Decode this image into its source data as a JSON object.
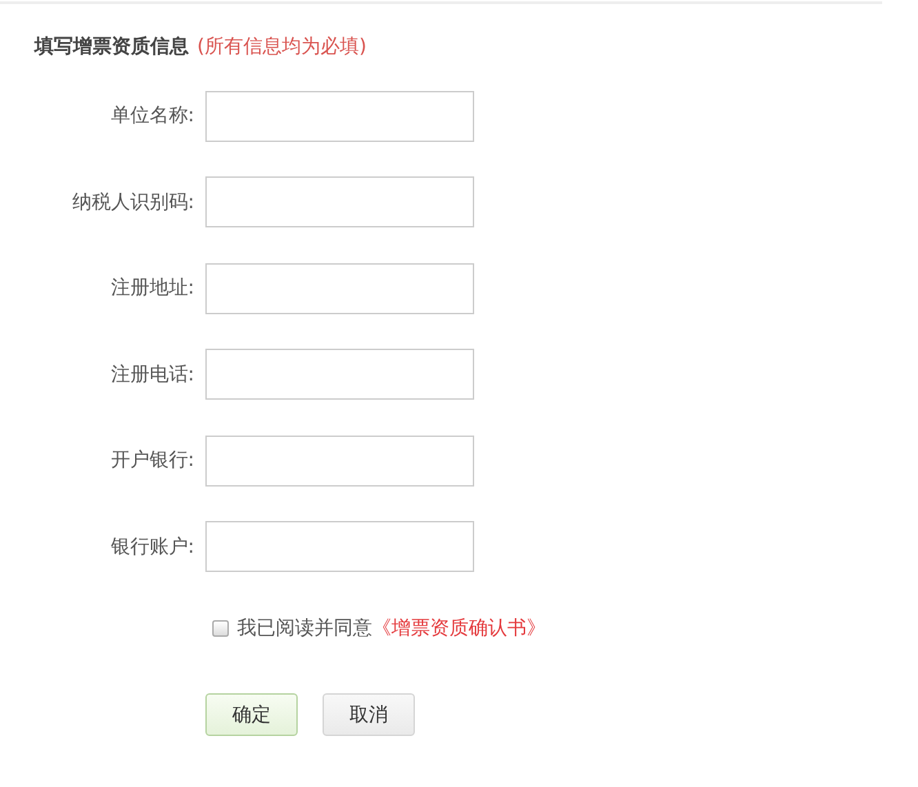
{
  "heading": {
    "title": "填写增票资质信息",
    "note": "(所有信息均为必填)"
  },
  "fields": [
    {
      "label": "单位名称:"
    },
    {
      "label": "纳税人识别码:"
    },
    {
      "label": "注册地址:"
    },
    {
      "label": "注册电话:"
    },
    {
      "label": "开户银行:"
    },
    {
      "label": "银行账户:"
    }
  ],
  "agreement": {
    "checked": false,
    "text": "我已阅读并同意",
    "link": "《增票资质确认书》"
  },
  "buttons": [
    {
      "label": "确定",
      "kind": "primary"
    },
    {
      "label": "取消",
      "kind": "default"
    }
  ]
}
